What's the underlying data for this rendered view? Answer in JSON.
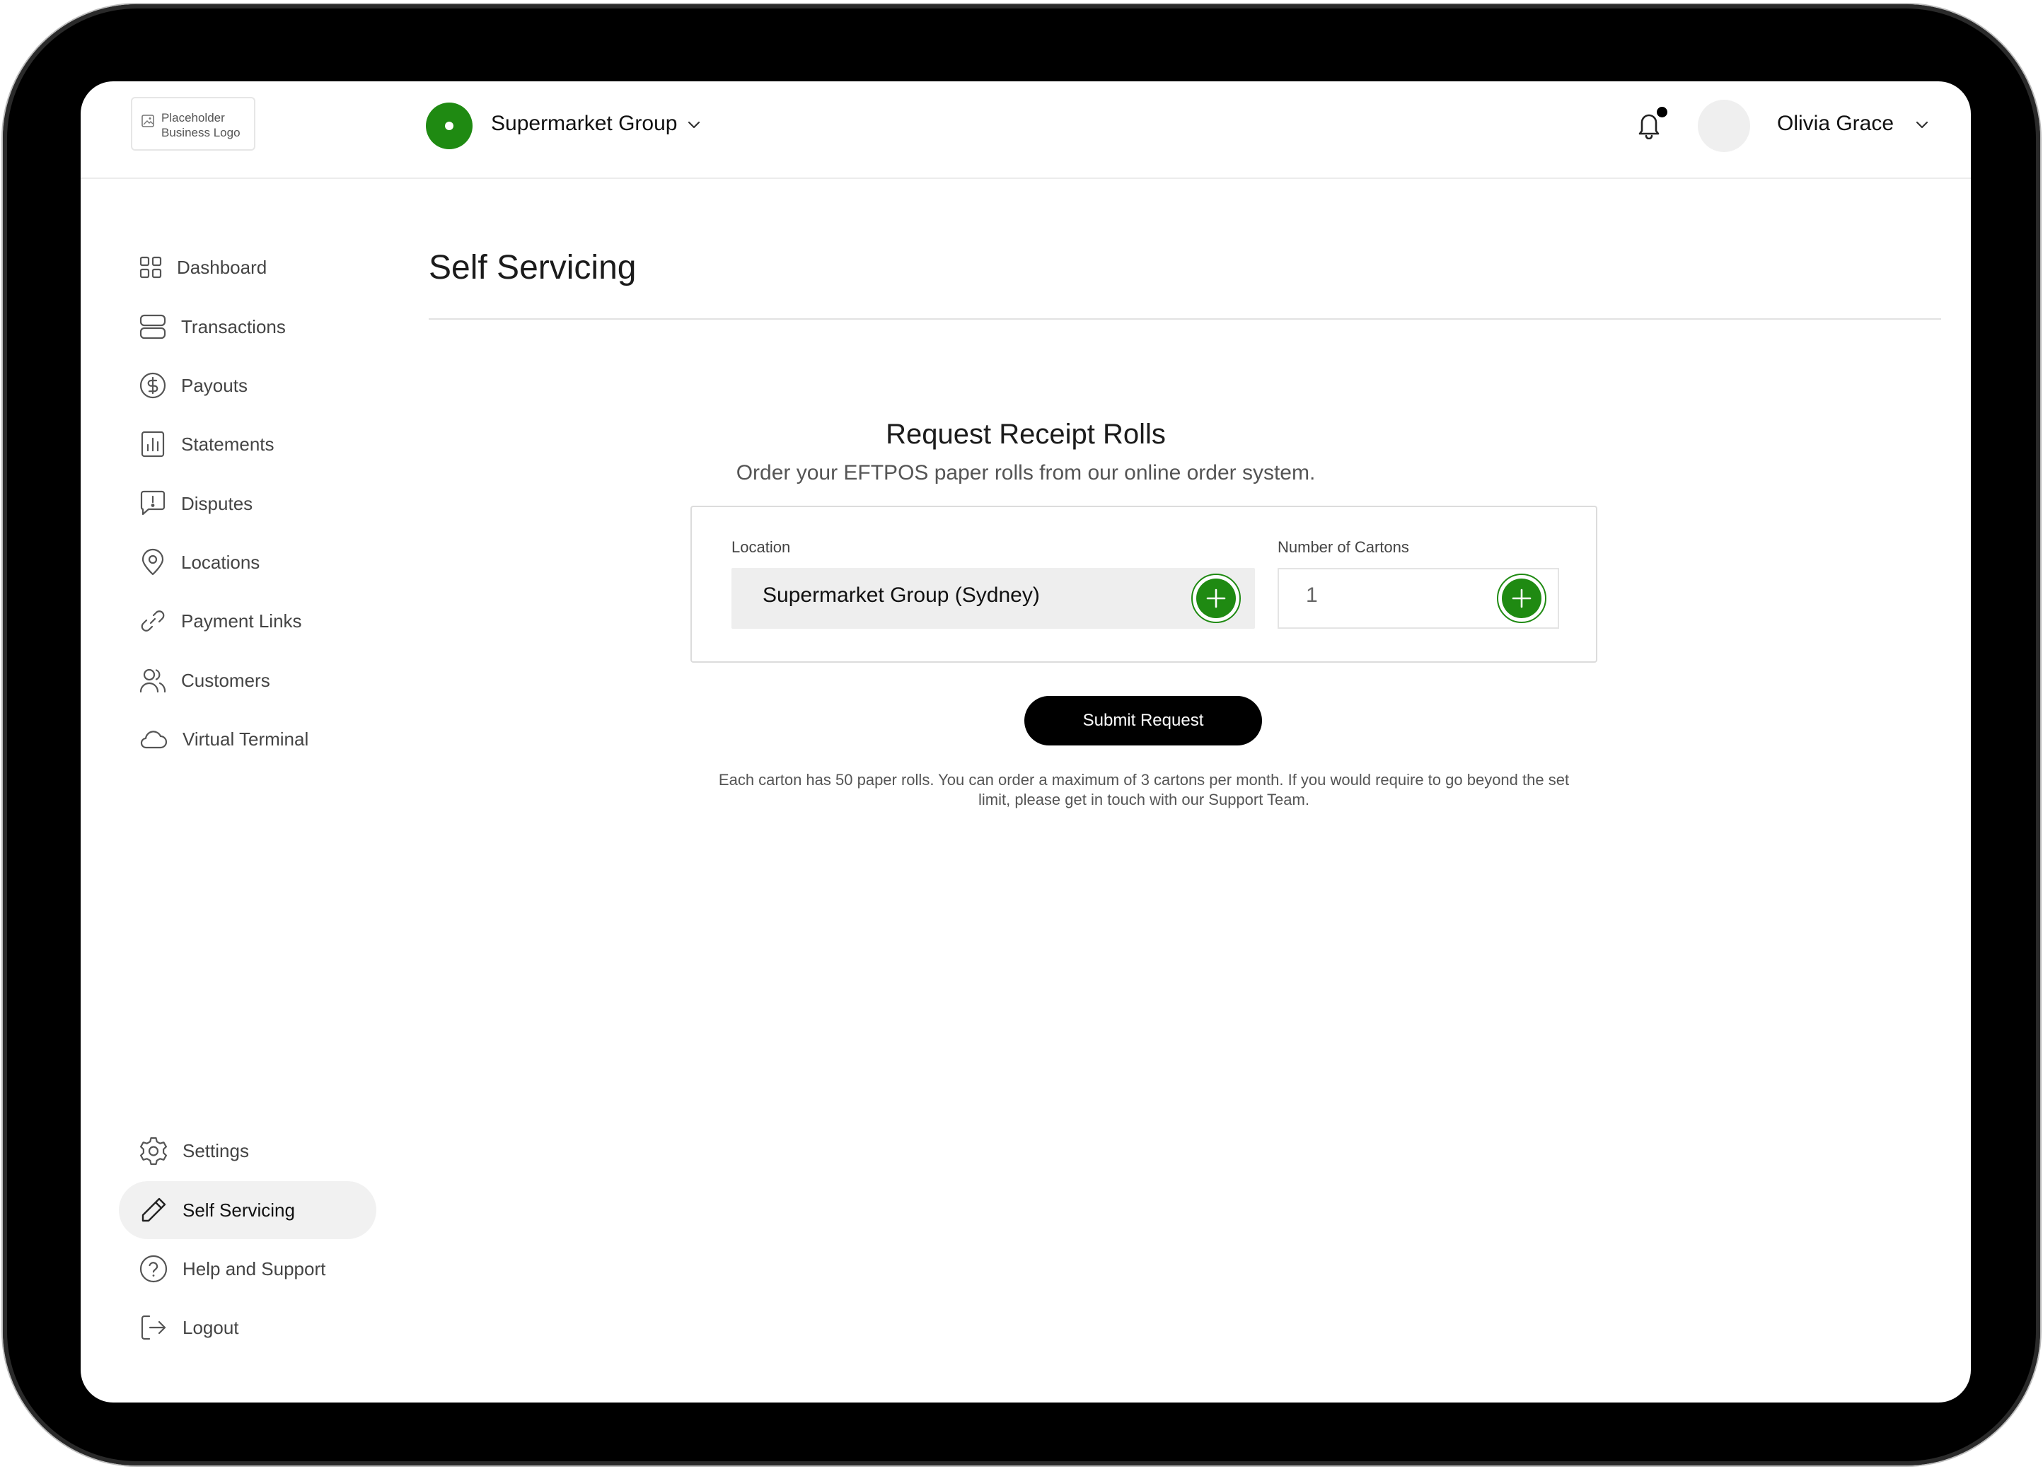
{
  "header": {
    "logo_text": "Placeholder Business Logo",
    "org_name": "Supermarket Group",
    "user_name": "Olivia Grace"
  },
  "sidebar": {
    "items": [
      {
        "label": "Dashboard",
        "icon": "grid-icon"
      },
      {
        "label": "Transactions",
        "icon": "server-stack-icon"
      },
      {
        "label": "Payouts",
        "icon": "dollar-circle-icon"
      },
      {
        "label": "Statements",
        "icon": "bar-chart-icon"
      },
      {
        "label": "Disputes",
        "icon": "message-alert-icon"
      },
      {
        "label": "Locations",
        "icon": "map-pin-icon"
      },
      {
        "label": "Payment Links",
        "icon": "link-icon"
      },
      {
        "label": "Customers",
        "icon": "users-icon"
      },
      {
        "label": "Virtual Terminal",
        "icon": "cloud-icon"
      }
    ],
    "bottom_items": [
      {
        "label": "Settings",
        "icon": "gear-icon"
      },
      {
        "label": "Self Servicing",
        "icon": "pencil-icon",
        "active": true
      },
      {
        "label": "Help and Support",
        "icon": "help-circle-icon"
      },
      {
        "label": "Logout",
        "icon": "logout-icon"
      }
    ]
  },
  "main": {
    "page_title": "Self Servicing",
    "card_title": "Request Receipt Rolls",
    "card_subtitle": "Order your EFTPOS paper rolls from our online order system.",
    "location_label": "Location",
    "location_value": "Supermarket Group (Sydney)",
    "cartons_label": "Number of Cartons",
    "cartons_value": "1",
    "submit_label": "Submit Request",
    "note": "Each carton has 50 paper rolls. You can order a maximum of 3 cartons per month. If you would require to go beyond the set limit, please get in touch with our Support Team."
  },
  "colors": {
    "accent": "#1f8a12",
    "button": "#000000",
    "active_nav": "#f1f1f1"
  }
}
